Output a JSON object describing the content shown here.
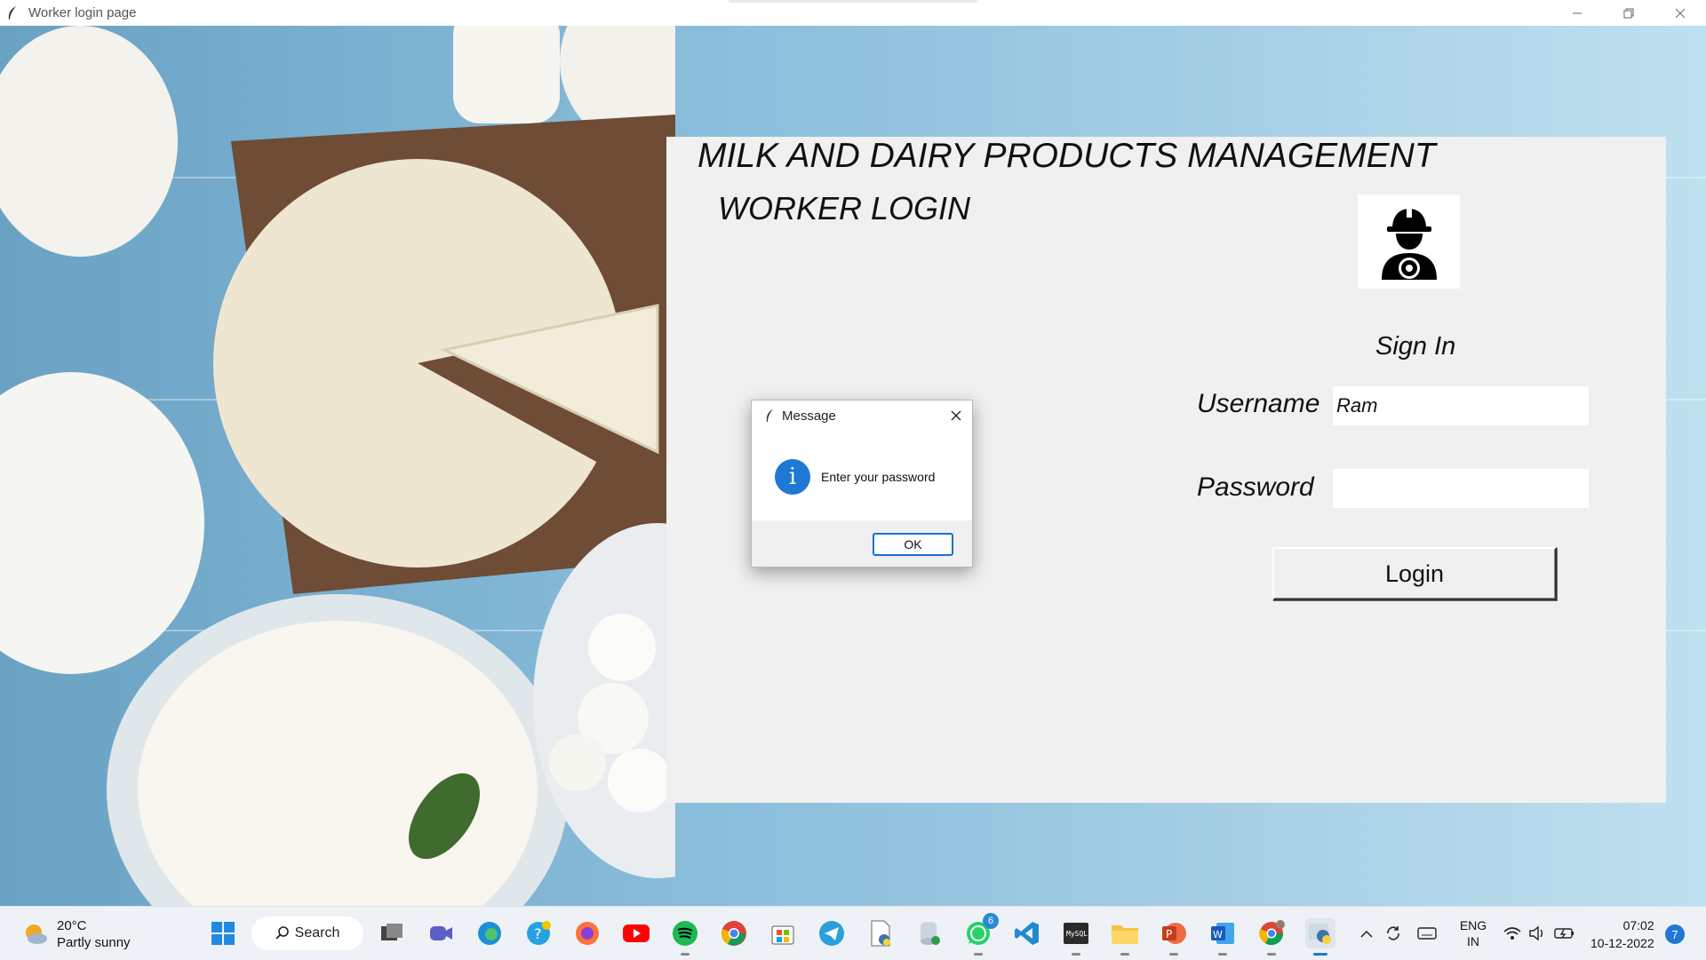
{
  "window": {
    "title": "Worker login page"
  },
  "panel": {
    "heading": "MILK AND DAIRY PRODUCTS MANAGEMENT",
    "subheading": "WORKER LOGIN",
    "signin_label": "Sign In",
    "username_label": "Username",
    "username_value": "Ram",
    "password_label": "Password",
    "password_value": "",
    "login_button": "Login"
  },
  "dialog": {
    "title": "Message",
    "message": "Enter your password",
    "ok_button": "OK",
    "icon": "info-icon"
  },
  "taskbar": {
    "weather_temp": "20°C",
    "weather_desc": "Partly sunny",
    "search_label": "Search",
    "whatsapp_badge": "6",
    "language_line1": "ENG",
    "language_line2": "IN",
    "time": "07:02",
    "date": "10-12-2022",
    "notification_count": "7"
  },
  "colors": {
    "panel_bg": "#f0f0f0",
    "accent_blue": "#1e78d4",
    "taskbar_bg": "#eef2f6"
  }
}
